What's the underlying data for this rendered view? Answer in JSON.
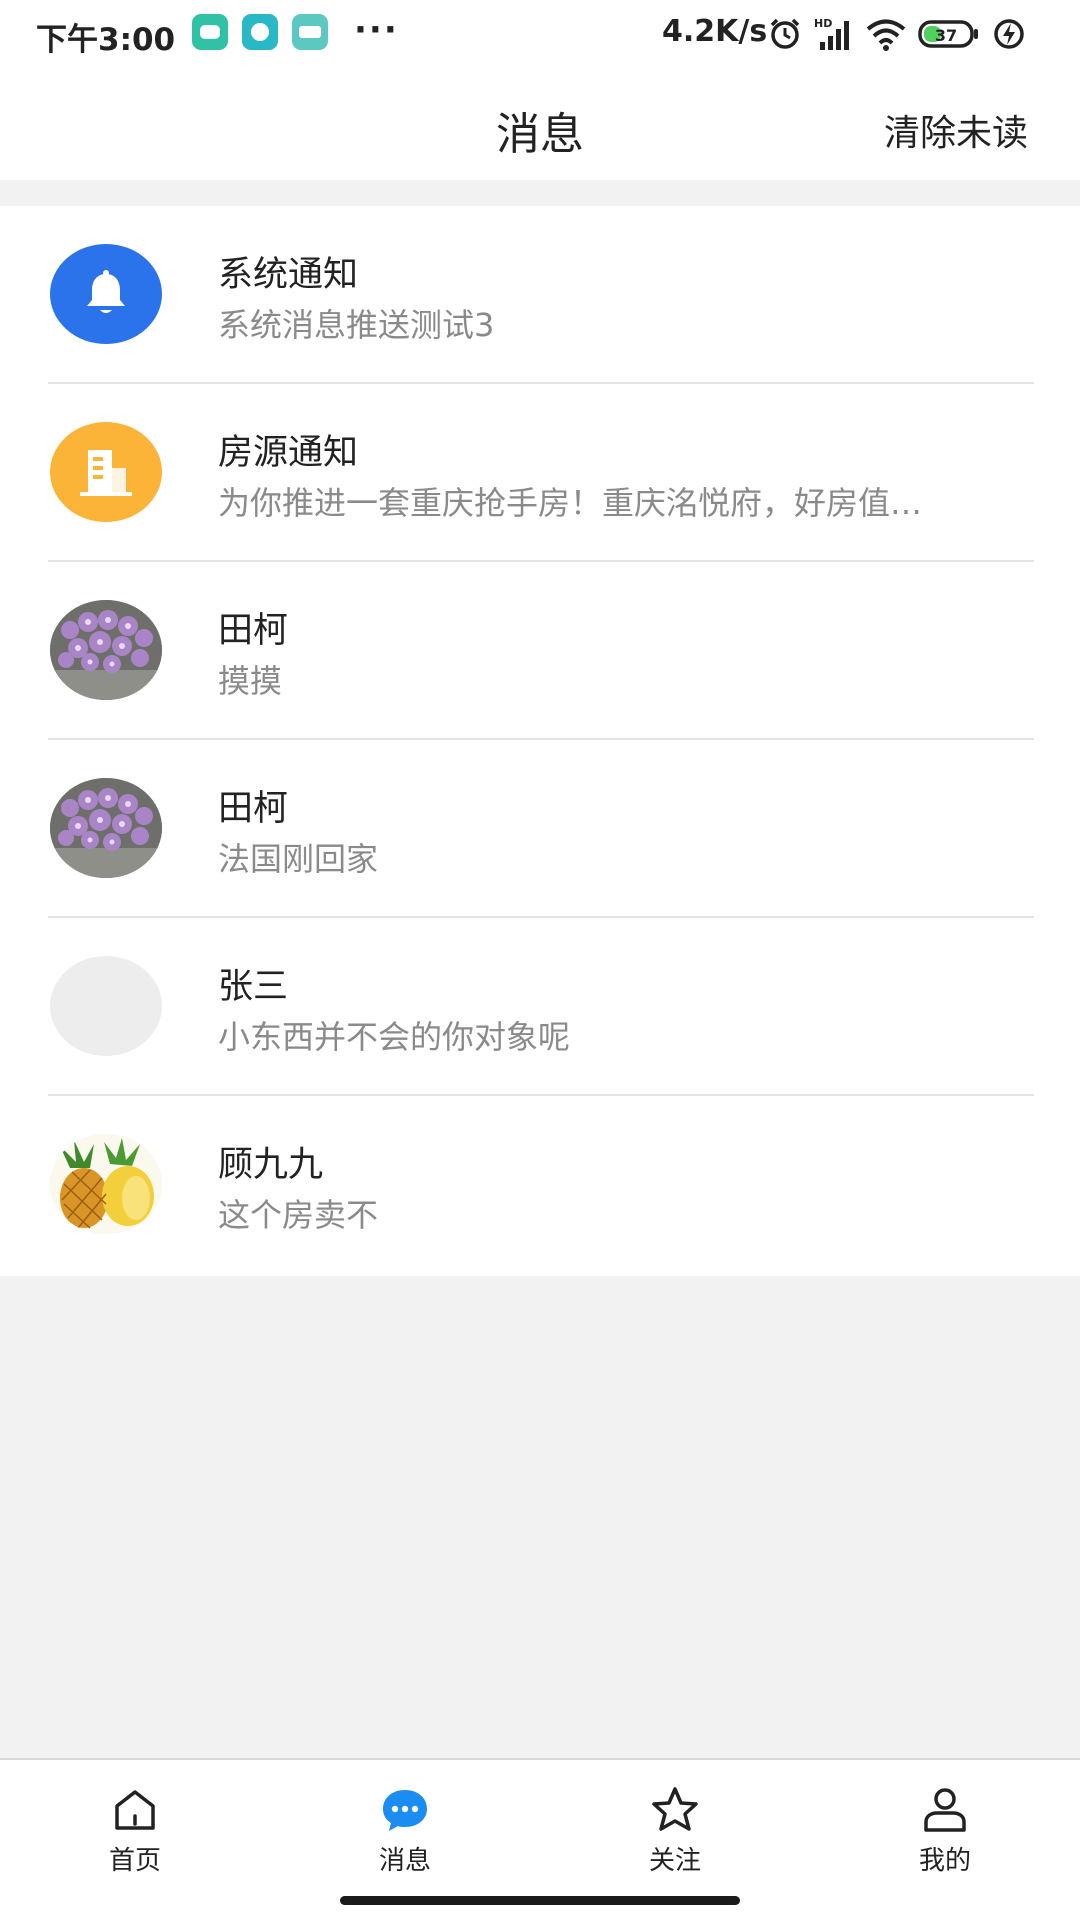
{
  "status_bar": {
    "time": "下午3:00",
    "overflow": "···",
    "net_speed": "4.2K/s",
    "network_badge": "HD",
    "battery_level": "37",
    "app_icons": [
      "chat-app-icon",
      "download-app-icon",
      "boss-app-icon"
    ]
  },
  "header": {
    "title": "消息",
    "action_label": "清除未读"
  },
  "messages": [
    {
      "name": "系统通知",
      "preview": "系统消息推送测试3",
      "avatar": "bell-icon",
      "avatar_color": "#2b73ea"
    },
    {
      "name": "房源通知",
      "preview": "为你推进一套重庆抢手房！重庆洺悦府，好房值…",
      "avatar": "building-icon",
      "avatar_color": "#fbb438"
    },
    {
      "name": "田柯",
      "preview": "摸摸",
      "avatar": "flowers-photo"
    },
    {
      "name": "田柯",
      "preview": "法国刚回家",
      "avatar": "flowers-photo"
    },
    {
      "name": "张三",
      "preview": "小东西并不会的你对象呢",
      "avatar": "placeholder-avatar"
    },
    {
      "name": "顾九九",
      "preview": "这个房卖不",
      "avatar": "pineapple-photo"
    }
  ],
  "bottom_nav": [
    {
      "label": "首页",
      "icon": "home-icon",
      "active": false
    },
    {
      "label": "消息",
      "icon": "chat-bubble-icon",
      "active": true
    },
    {
      "label": "关注",
      "icon": "star-icon",
      "active": false
    },
    {
      "label": "我的",
      "icon": "person-icon",
      "active": false
    }
  ],
  "colors": {
    "accent": "#2b73ea",
    "notice_orange": "#fbb438",
    "active_tab": "#1b8cf2",
    "preview_text": "#8a8a8a",
    "page_background": "#f2f2f2"
  }
}
